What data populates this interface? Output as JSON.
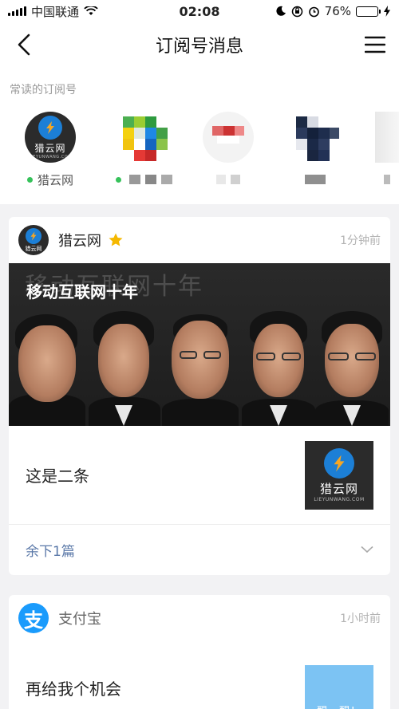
{
  "status_bar": {
    "carrier": "中国联通",
    "time": "02:08",
    "battery": "76%",
    "battery_level": 0.76
  },
  "nav": {
    "title": "订阅号消息",
    "back_icon": "back-arrow-icon",
    "menu_icon": "menu-icon"
  },
  "frequent": {
    "label": "常读的订阅号",
    "accounts": [
      {
        "name": "猎云网",
        "online": true,
        "blurred": false
      },
      {
        "name": "",
        "online": true,
        "blurred": true
      },
      {
        "name": "",
        "online": false,
        "blurred": true
      },
      {
        "name": "",
        "online": false,
        "blurred": true
      }
    ]
  },
  "cards": [
    {
      "account": "猎云网",
      "starred": true,
      "time": "1分钟前",
      "cover_title": "移动互联网十年",
      "cover_bg_text": "移动互联网十年",
      "logo_text": "猎云网",
      "logo_sub": "LIEYUNWANG.COM",
      "item_title": "这是二条",
      "more_label": "余下1篇"
    },
    {
      "account": "支付宝",
      "icon_char": "支",
      "time": "1小时前",
      "item_title": "再给我个机会",
      "thumb_text": "醒一醒！"
    }
  ],
  "colors": {
    "accent_green": "#36c25a",
    "alipay_blue": "#1a9bfc",
    "link_blue": "#5a78a8"
  }
}
